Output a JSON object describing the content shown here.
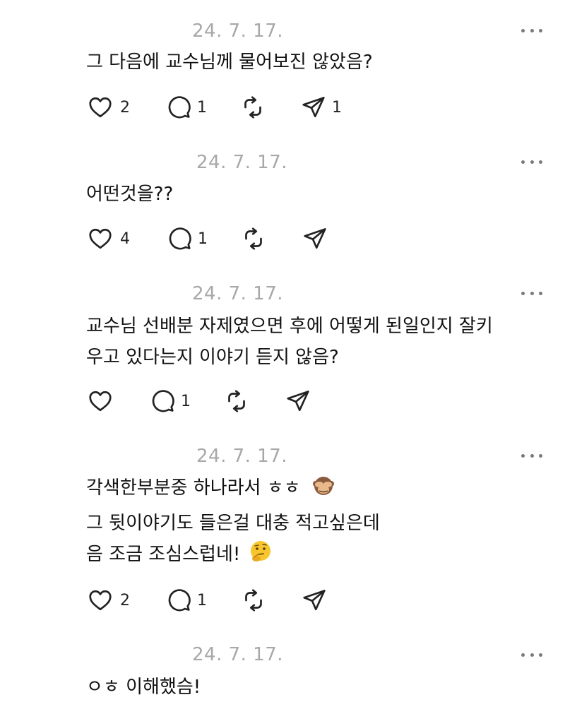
{
  "posts": [
    {
      "timestamp": "24. 7. 17.",
      "lines": [
        "그 다음에 교수님께 물어보진 않았음?"
      ],
      "likes": "2",
      "replies": "1",
      "shares": "1"
    },
    {
      "timestamp": "24. 7. 17.",
      "lines": [
        "어떤것을??"
      ],
      "likes": "4",
      "replies": "1",
      "shares": ""
    },
    {
      "timestamp": "24. 7. 17.",
      "lines": [
        "교수님 선배분 자제였으면 후에 어떻게 된일인지 잘키",
        "우고 있다는지 이야기 듣지 않음?"
      ],
      "likes": "",
      "replies": "1",
      "shares": ""
    },
    {
      "timestamp": "24. 7. 17.",
      "lines": [
        "각색한부분중 하나라서 ㅎㅎ",
        "그 뒷이야기도 들은걸 대충 적고싶은데",
        "음 조금 조심스럽네!"
      ],
      "emojis": [
        "see-no-evil-monkey",
        "thinking-face"
      ],
      "likes": "2",
      "replies": "1",
      "shares": ""
    },
    {
      "timestamp": "24. 7. 17.",
      "lines": [
        "ㅇㅎ 이해했슴!"
      ]
    }
  ],
  "icons": {
    "like": "heart-icon",
    "reply": "comment-icon",
    "repost": "repost-icon",
    "share": "send-icon",
    "more": "more-icon"
  },
  "colors": {
    "timestamp": "#a8a8a8",
    "text": "#111111",
    "icon": "#222222"
  }
}
